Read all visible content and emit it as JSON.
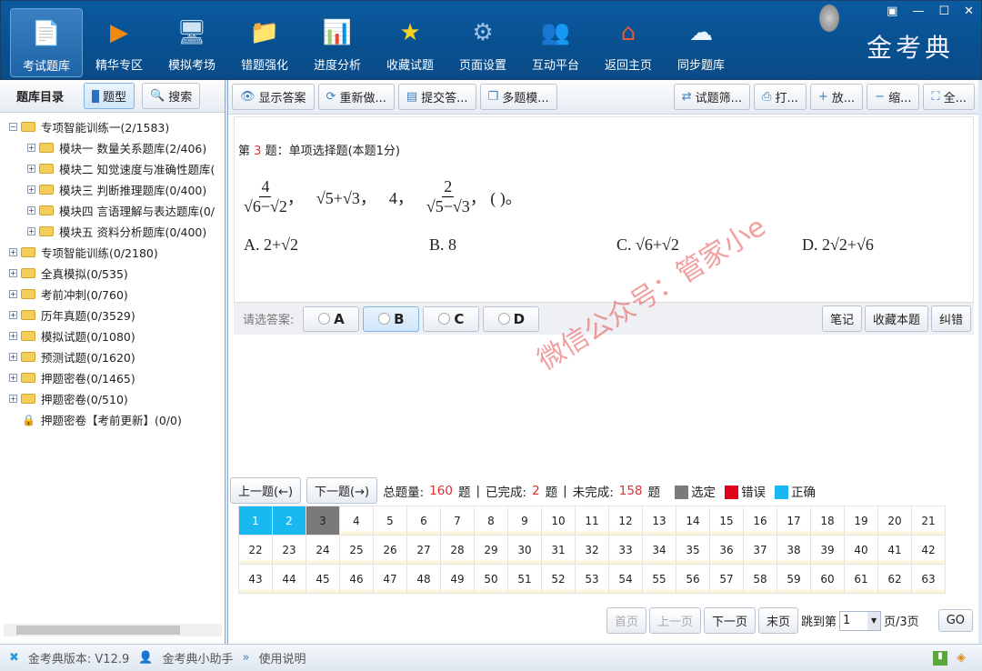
{
  "header": {
    "nav": [
      {
        "label": "考试题库",
        "icon": "document-stack-icon",
        "glyph": "📄",
        "active": true
      },
      {
        "label": "精华专区",
        "icon": "play-icon",
        "glyph": "▶"
      },
      {
        "label": "模拟考场",
        "icon": "monitor-icon",
        "glyph": "🖥"
      },
      {
        "label": "错题强化",
        "icon": "folder-chart-icon",
        "glyph": "📁"
      },
      {
        "label": "进度分析",
        "icon": "chart-board-icon",
        "glyph": "📊"
      },
      {
        "label": "收藏试题",
        "icon": "star-icon",
        "glyph": "★"
      },
      {
        "label": "页面设置",
        "icon": "gear-icon",
        "glyph": "⚙"
      },
      {
        "label": "互动平台",
        "icon": "users-icon",
        "glyph": "👥"
      },
      {
        "label": "返回主页",
        "icon": "home-icon",
        "glyph": "⌂"
      },
      {
        "label": "同步题库",
        "icon": "cloud-sync-icon",
        "glyph": "☁"
      }
    ],
    "logo": "金考典"
  },
  "left": {
    "title": "题库目录",
    "tab_type": "题型",
    "tab_search": "搜索",
    "tree": [
      {
        "label": "专项智能训练一(2/1583)",
        "expanded": true,
        "children": [
          "模块一  数量关系题库(2/406)",
          "模块二  知觉速度与准确性题库(",
          "模块三  判断推理题库(0/400)",
          "模块四  言语理解与表达题库(0/",
          "模块五  资料分析题库(0/400)"
        ]
      },
      {
        "label": "专项智能训练(0/2180)"
      },
      {
        "label": "全真模拟(0/535)"
      },
      {
        "label": "考前冲刺(0/760)"
      },
      {
        "label": "历年真题(0/3529)"
      },
      {
        "label": "模拟试题(0/1080)"
      },
      {
        "label": "预测试题(0/1620)"
      },
      {
        "label": "押题密卷(0/1465)"
      },
      {
        "label": "押题密卷(0/510)"
      },
      {
        "label": "押题密卷【考前更新】(0/0)",
        "locked": true
      }
    ]
  },
  "toolbar": {
    "left": [
      "显示答案",
      "重新做...",
      "提交答...",
      "多题模..."
    ],
    "right": [
      "试题筛...",
      "打...",
      "放...",
      "缩...",
      "全..."
    ]
  },
  "question": {
    "prefix": "第",
    "number": "3",
    "suffix": "题：单项选择题(本题1分)",
    "stem": {
      "f1n": "4",
      "f1d": "√6−√2",
      "t2": "√5+√3，",
      "t3": "4，",
      "f2n": "2",
      "f2d": "√5−√3",
      "t4": "，  (      )。",
      "c1": "，"
    },
    "options": [
      "A.  2+√2",
      "B.  8",
      "C.  √6+√2",
      "D.  2√2+√6"
    ]
  },
  "answer": {
    "label": "请选答案:",
    "choices": [
      "A",
      "B",
      "C",
      "D"
    ],
    "note": "笔记",
    "favorite": "收藏本题",
    "report": "纠错"
  },
  "watermark": "微信公众号：管家小e",
  "nav": {
    "prev": "上一题(←)",
    "next": "下一题(→)",
    "total_label": "总题量:",
    "total": "160",
    "unit": "题",
    "done_label": "已完成:",
    "done": "2",
    "todo_label": "未完成:",
    "todo": "158",
    "legend": [
      {
        "label": "选定",
        "color": "#7a7a7a"
      },
      {
        "label": "错误",
        "color": "#e0001b"
      },
      {
        "label": "正确",
        "color": "#19b8f0"
      }
    ]
  },
  "grid": {
    "first": 1,
    "last": 63,
    "correct": [
      1,
      2
    ],
    "selected": 3
  },
  "pager": {
    "first": "首页",
    "prev": "上一页",
    "next": "下一页",
    "last": "末页",
    "jump": "跳到第",
    "page": "1",
    "of": "页/3页",
    "go": "GO"
  },
  "status": {
    "version": "金考典版本: V12.9",
    "helper": "金考典小助手",
    "manual": "使用说明"
  }
}
